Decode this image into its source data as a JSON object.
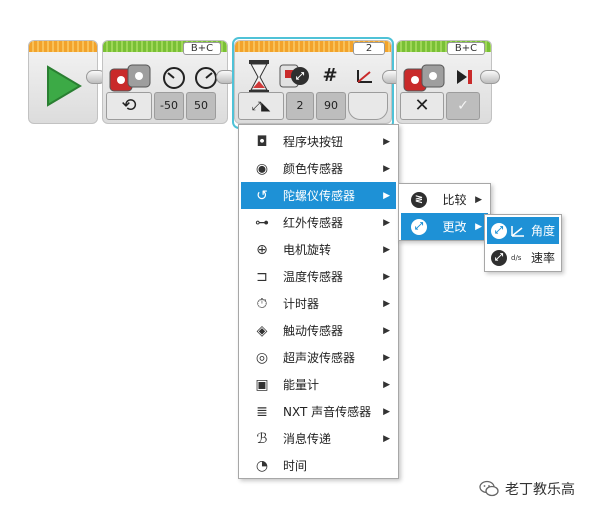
{
  "program": {
    "start_block": {
      "icon": "play-icon"
    },
    "motor_block_1": {
      "port": "B+C",
      "mode_icon": "rotate-mode-icon",
      "param_steering": "-50",
      "param_power": "50"
    },
    "gyro_block": {
      "port": "2",
      "param_icon": "gyro-angle-icon",
      "param_port": "2",
      "param_value": "90"
    },
    "motor_block_2": {
      "port": "B+C",
      "param_brake": "✓"
    }
  },
  "menu_main": {
    "items": [
      {
        "icon": "brick-buttons-icon",
        "glyph": "◘",
        "label": "程序块按钮"
      },
      {
        "icon": "color-sensor-icon",
        "glyph": "◉",
        "label": "颜色传感器"
      },
      {
        "icon": "gyro-sensor-icon",
        "glyph": "↺",
        "label": "陀螺仪传感器"
      },
      {
        "icon": "infrared-sensor-icon",
        "glyph": "⊶",
        "label": "红外传感器"
      },
      {
        "icon": "motor-rotation-icon",
        "glyph": "⊕",
        "label": "电机旋转"
      },
      {
        "icon": "temperature-sensor-icon",
        "glyph": "⊐",
        "label": "温度传感器"
      },
      {
        "icon": "timer-icon",
        "glyph": "⏱",
        "label": "计时器"
      },
      {
        "icon": "touch-sensor-icon",
        "glyph": "◈",
        "label": "触动传感器"
      },
      {
        "icon": "ultrasonic-sensor-icon",
        "glyph": "◎",
        "label": "超声波传感器"
      },
      {
        "icon": "energy-meter-icon",
        "glyph": "▣",
        "label": "能量计"
      },
      {
        "icon": "nxt-sound-sensor-icon",
        "glyph": "≣",
        "label": "NXT 声音传感器"
      },
      {
        "icon": "messaging-icon",
        "glyph": "ℬ",
        "label": "消息传递"
      },
      {
        "icon": "time-icon",
        "glyph": "◔",
        "label": "时间"
      }
    ],
    "selected_index": 2
  },
  "menu_gyro": {
    "items": [
      {
        "icon": "compare-icon",
        "label": "比较"
      },
      {
        "icon": "change-icon",
        "label": "更改"
      }
    ],
    "selected_index": 1
  },
  "menu_change": {
    "items": [
      {
        "icon": "angle-icon",
        "label": "角度"
      },
      {
        "icon": "rate-icon",
        "prefix": "d/s",
        "label": "速率"
      }
    ],
    "selected_index": 0
  },
  "watermark": {
    "icon": "wechat-icon",
    "text": "老丁教乐高"
  },
  "colors": {
    "selection": "#1e91d6",
    "block_outline": "#4fc2d7",
    "head_green": "#79c036",
    "head_orange": "#f2a32c"
  }
}
